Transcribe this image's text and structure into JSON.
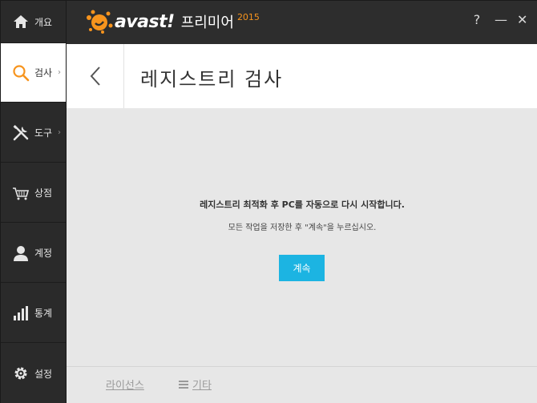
{
  "titlebar": {
    "brand": "avast!",
    "product": "프리미어",
    "year": "2015",
    "help": "?",
    "minimize": "—",
    "close": "✕"
  },
  "sidebar": {
    "items": [
      {
        "label": "개요",
        "icon": "home-icon"
      },
      {
        "label": "검사",
        "icon": "search-icon",
        "chevron": "›"
      },
      {
        "label": "도구",
        "icon": "tools-icon",
        "chevron": "›"
      },
      {
        "label": "상점",
        "icon": "cart-icon"
      },
      {
        "label": "계정",
        "icon": "user-icon"
      },
      {
        "label": "통계",
        "icon": "stats-icon"
      },
      {
        "label": "설정",
        "icon": "gear-icon"
      }
    ]
  },
  "main": {
    "title": "레지스트리 검사",
    "message_bold": "레지스트리 최적화 후 PC를 자동으로 다시 시작합니다.",
    "message": "모든 작업을 저장한 후 \"계속\"을 누르십시오.",
    "continue_label": "계속"
  },
  "footer": {
    "license": "라이선스",
    "more": "기타"
  },
  "colors": {
    "accent": "#1cb4e2",
    "brand_orange": "#f7941d",
    "sidebar_bg": "#2a2a2a"
  }
}
